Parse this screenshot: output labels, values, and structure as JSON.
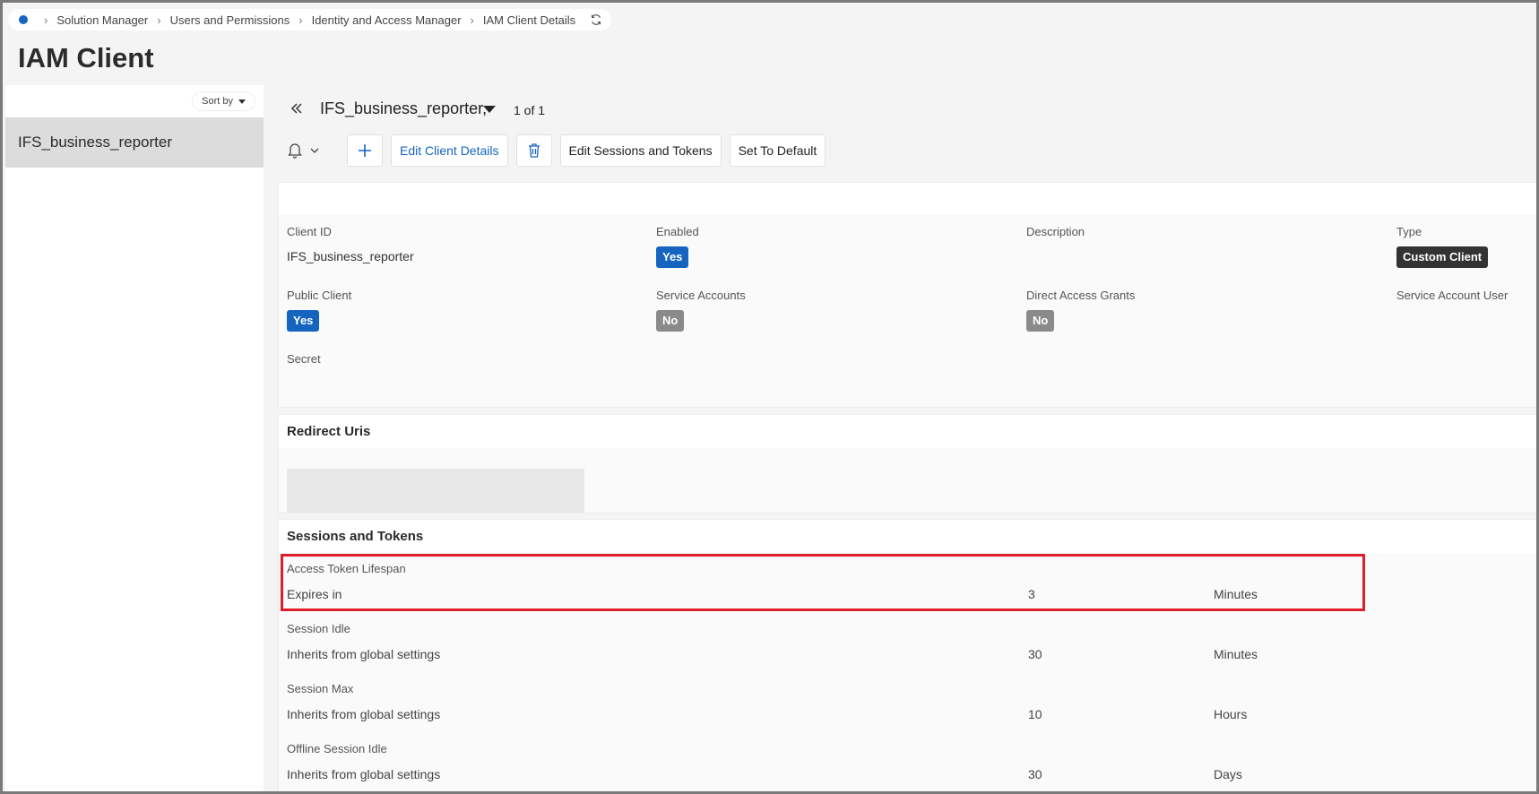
{
  "breadcrumb": {
    "items": [
      "Solution Manager",
      "Users and Permissions",
      "Identity and Access Manager",
      "IAM Client Details"
    ]
  },
  "page": {
    "title": "IAM Client"
  },
  "navigator": {
    "sort_label": "Sort by",
    "items": [
      {
        "label": "IFS_business_reporter",
        "selected": true
      }
    ]
  },
  "record": {
    "title": "IFS_business_reporter,",
    "count": "1 of 1"
  },
  "toolbar": {
    "edit_client_details": "Edit Client Details",
    "edit_sessions_tokens": "Edit Sessions and Tokens",
    "set_default": "Set To Default"
  },
  "details": {
    "client_id_label": "Client ID",
    "client_id_value": "IFS_business_reporter",
    "enabled_label": "Enabled",
    "enabled_value": "Yes",
    "description_label": "Description",
    "type_label": "Type",
    "type_value": "Custom Client",
    "public_client_label": "Public Client",
    "public_client_value": "Yes",
    "service_accounts_label": "Service Accounts",
    "service_accounts_value": "No",
    "direct_access_label": "Direct Access Grants",
    "direct_access_value": "No",
    "service_account_user_label": "Service Account User",
    "secret_label": "Secret"
  },
  "redirect": {
    "title": "Redirect Uris"
  },
  "sessions": {
    "title": "Sessions and Tokens",
    "rows": [
      {
        "label": "Access Token Lifespan",
        "desc": "Expires in",
        "value": "3",
        "unit": "Minutes"
      },
      {
        "label": "Session Idle",
        "desc": "Inherits from global settings",
        "value": "30",
        "unit": "Minutes"
      },
      {
        "label": "Session Max",
        "desc": "Inherits from global settings",
        "value": "10",
        "unit": "Hours"
      },
      {
        "label": "Offline Session Idle",
        "desc": "Inherits from global settings",
        "value": "30",
        "unit": "Days"
      }
    ]
  },
  "colors": {
    "accent": "#1565c0",
    "highlight": "#e01e2b",
    "badge_no": "#8a8a8a",
    "badge_dark": "#333333"
  },
  "icons": [
    "home-dot-icon",
    "chevron-right-icon",
    "refresh-icon",
    "chevrons-left-icon",
    "caret-down-icon",
    "bell-icon",
    "plus-icon",
    "trash-icon"
  ]
}
